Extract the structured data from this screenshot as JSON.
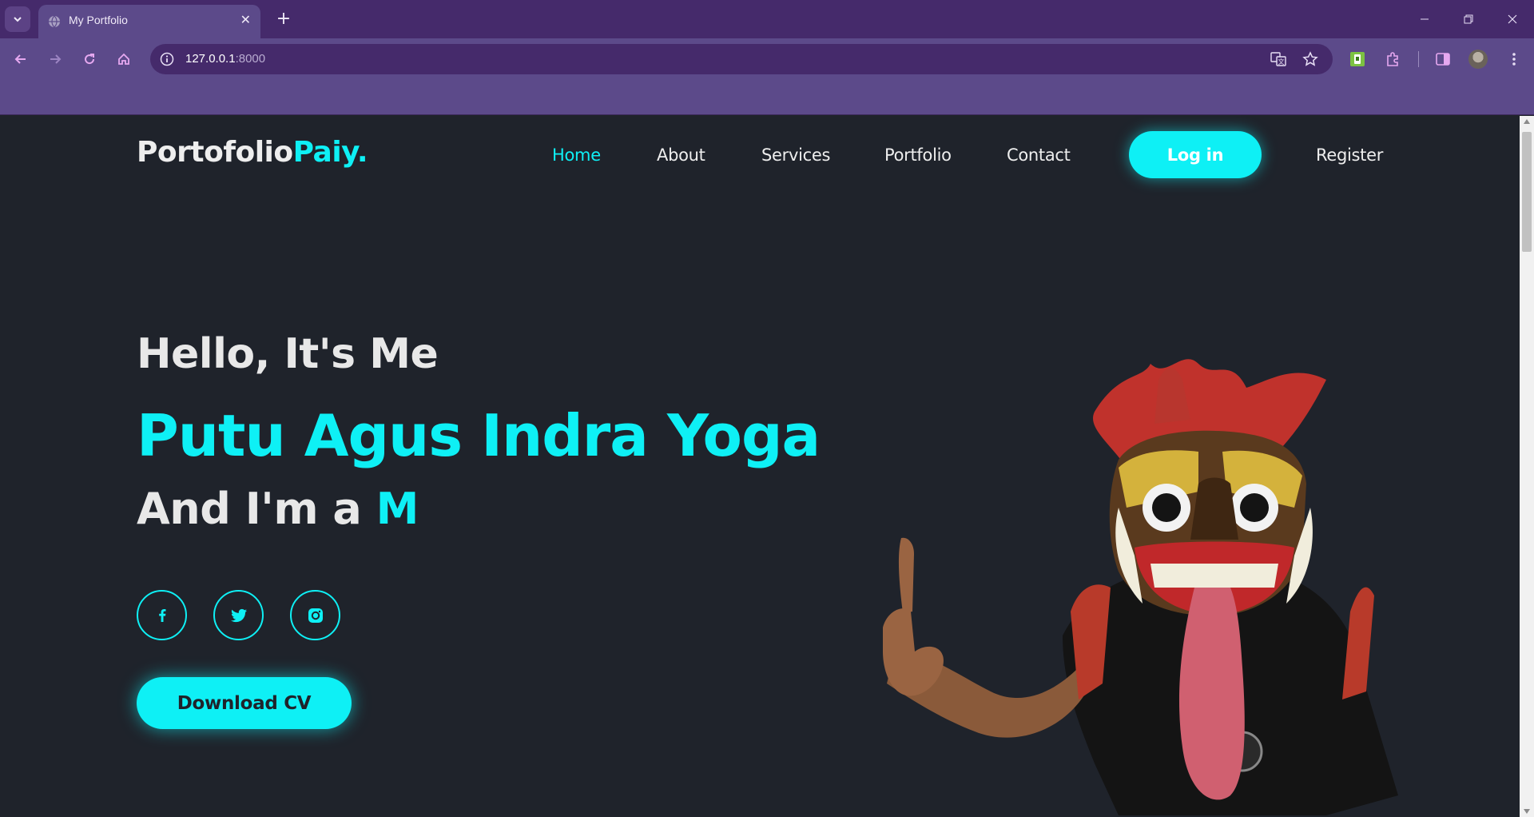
{
  "browser": {
    "tab_title": "My Portfolio",
    "url_host": "127.0.0.1",
    "url_port": ":8000"
  },
  "site": {
    "logo_main": "Portofolio",
    "logo_accent": "Paiy.",
    "nav": {
      "home": "Home",
      "about": "About",
      "services": "Services",
      "portfolio": "Portfolio",
      "contact": "Contact",
      "login": "Log in",
      "register": "Register"
    },
    "hero": {
      "greeting": "Hello, It's Me",
      "name": "Putu Agus Indra Yoga",
      "role_prefix": "And I'm a ",
      "role_typed": "M",
      "download_cv": "Download CV"
    }
  },
  "colors": {
    "accent": "#0ef0f5",
    "page_bg": "#1f232b",
    "chrome_dark": "#452a6b",
    "chrome_light": "#5c4a8a"
  },
  "icons": [
    "facebook-icon",
    "twitter-icon",
    "instagram-icon",
    "translate-icon",
    "star-icon",
    "extensions-icon",
    "side-panel-icon"
  ]
}
